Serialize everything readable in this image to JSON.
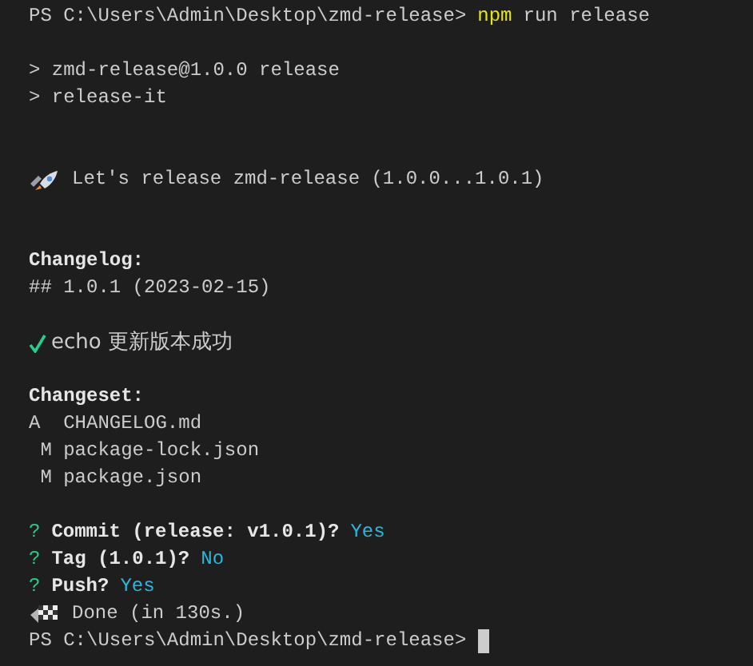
{
  "lines": [
    {
      "kind": "prompt",
      "prompt": "PS C:\\Users\\Admin\\Desktop\\zmd-release>",
      "command": "npm",
      "args": "run release",
      "cursor": false
    },
    {
      "kind": "blank"
    },
    {
      "kind": "output",
      "text": "> zmd-release@1.0.0 release"
    },
    {
      "kind": "output",
      "text": "> release-it"
    },
    {
      "kind": "blank"
    },
    {
      "kind": "blank"
    },
    {
      "kind": "rocket",
      "text": "Let's release zmd-release (1.0.0...1.0.1)"
    },
    {
      "kind": "blank"
    },
    {
      "kind": "blank"
    },
    {
      "kind": "heading",
      "text": "Changelog:"
    },
    {
      "kind": "output",
      "text": "## 1.0.1 (2023-02-15)"
    },
    {
      "kind": "blank"
    },
    {
      "kind": "success",
      "text": "echo 更新版本成功"
    },
    {
      "kind": "blank"
    },
    {
      "kind": "heading",
      "text": "Changeset:"
    },
    {
      "kind": "output",
      "text": "A  CHANGELOG.md"
    },
    {
      "kind": "output",
      "text": " M package-lock.json"
    },
    {
      "kind": "output",
      "text": " M package.json"
    },
    {
      "kind": "blank"
    },
    {
      "kind": "question",
      "mark": "?",
      "question": "Commit (release: v1.0.1)?",
      "answer": "Yes"
    },
    {
      "kind": "question",
      "mark": "?",
      "question": "Tag (1.0.1)?",
      "answer": "No"
    },
    {
      "kind": "question",
      "mark": "?",
      "question": "Push?",
      "answer": "Yes"
    },
    {
      "kind": "flag",
      "text": "Done (in 130s.)"
    },
    {
      "kind": "prompt",
      "prompt": "PS C:\\Users\\Admin\\Desktop\\zmd-release>",
      "cursor": true
    }
  ]
}
